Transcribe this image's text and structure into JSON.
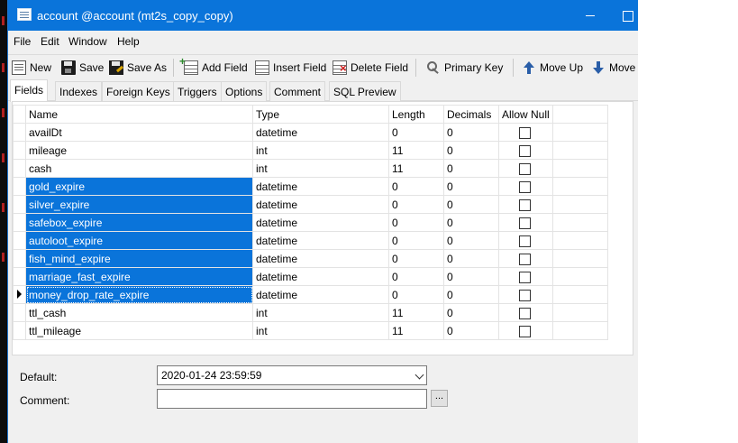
{
  "window": {
    "title": "account @account (mt2s_copy_copy)"
  },
  "menu": [
    "File",
    "Edit",
    "Window",
    "Help"
  ],
  "toolbar": {
    "new": "New",
    "save": "Save",
    "save_as": "Save As",
    "add_field": "Add Field",
    "insert_field": "Insert Field",
    "delete_field": "Delete Field",
    "primary_key": "Primary Key",
    "move_up": "Move Up",
    "move_down": "Move"
  },
  "tabs": [
    "Fields",
    "Indexes",
    "Foreign Keys",
    "Triggers",
    "Options",
    "Comment",
    "SQL Preview"
  ],
  "active_tab": "Fields",
  "grid": {
    "headers": {
      "name": "Name",
      "type": "Type",
      "length": "Length",
      "decimals": "Decimals",
      "allow_null": "Allow Null"
    },
    "rows": [
      {
        "name": "availDt",
        "type": "datetime",
        "length": "0",
        "decimals": "0",
        "allow_null": false,
        "selected": false
      },
      {
        "name": "mileage",
        "type": "int",
        "length": "11",
        "decimals": "0",
        "allow_null": false,
        "selected": false
      },
      {
        "name": "cash",
        "type": "int",
        "length": "11",
        "decimals": "0",
        "allow_null": false,
        "selected": false
      },
      {
        "name": "gold_expire",
        "type": "datetime",
        "length": "0",
        "decimals": "0",
        "allow_null": false,
        "selected": true
      },
      {
        "name": "silver_expire",
        "type": "datetime",
        "length": "0",
        "decimals": "0",
        "allow_null": false,
        "selected": true
      },
      {
        "name": "safebox_expire",
        "type": "datetime",
        "length": "0",
        "decimals": "0",
        "allow_null": false,
        "selected": true
      },
      {
        "name": "autoloot_expire",
        "type": "datetime",
        "length": "0",
        "decimals": "0",
        "allow_null": false,
        "selected": true
      },
      {
        "name": "fish_mind_expire",
        "type": "datetime",
        "length": "0",
        "decimals": "0",
        "allow_null": false,
        "selected": true
      },
      {
        "name": "marriage_fast_expire",
        "type": "datetime",
        "length": "0",
        "decimals": "0",
        "allow_null": false,
        "selected": true
      },
      {
        "name": "money_drop_rate_expire",
        "type": "datetime",
        "length": "0",
        "decimals": "0",
        "allow_null": false,
        "selected": true,
        "current": true
      },
      {
        "name": "ttl_cash",
        "type": "int",
        "length": "11",
        "decimals": "0",
        "allow_null": false,
        "selected": false
      },
      {
        "name": "ttl_mileage",
        "type": "int",
        "length": "11",
        "decimals": "0",
        "allow_null": false,
        "selected": false
      }
    ]
  },
  "properties": {
    "default_label": "Default:",
    "default_value": "2020-01-24 23:59:59",
    "comment_label": "Comment:",
    "comment_value": "",
    "comment_button": "..."
  },
  "colors": {
    "titlebar": "#0a74da",
    "selection": "#0a74da"
  }
}
